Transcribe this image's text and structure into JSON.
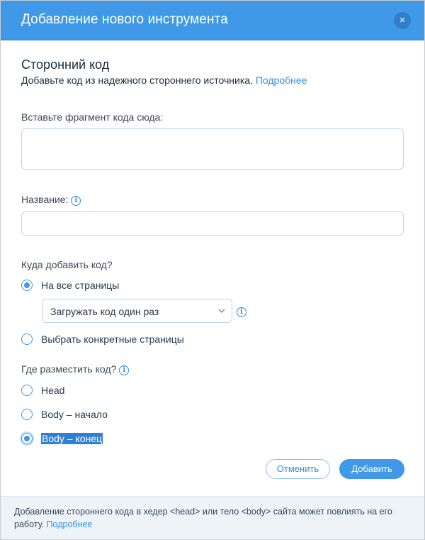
{
  "dialog": {
    "title": "Добавление нового инструмента",
    "close_icon": "×"
  },
  "intro": {
    "title": "Сторонний код",
    "subtitle": "Добавьте код из надежного стороннего источника.",
    "learn_more": "Подробнее"
  },
  "code_field": {
    "label": "Вставьте фрагмент кода сюда:",
    "value": "",
    "placeholder": ""
  },
  "name_field": {
    "label": "Название:",
    "info_icon": "i",
    "value": "",
    "placeholder": ""
  },
  "placement_pages": {
    "question": "Куда добавить код?",
    "options": [
      {
        "label": "На все страницы",
        "checked": true
      },
      {
        "label": "Выбрать конкретные страницы",
        "checked": false
      }
    ],
    "load_dropdown": {
      "selected": "Загружать код один раз",
      "info_icon": "i"
    }
  },
  "placement_position": {
    "question": "Где разместить код?",
    "info_icon": "i",
    "options": [
      {
        "label": "Head",
        "checked": false
      },
      {
        "label": "Body – начало",
        "checked": false
      },
      {
        "label": "Body – конец",
        "checked": true
      }
    ]
  },
  "actions": {
    "cancel_label": "Отменить",
    "add_label": "Добавить"
  },
  "footer": {
    "note": "Добавление стороннего кода в хедер <head> или тело <body> сайта может повлиять на его работу.",
    "learn_more": "Подробнее"
  },
  "colors": {
    "header": "#3f99e6",
    "accent": "#2f8fe2",
    "footer_bg": "#eef3f8"
  }
}
